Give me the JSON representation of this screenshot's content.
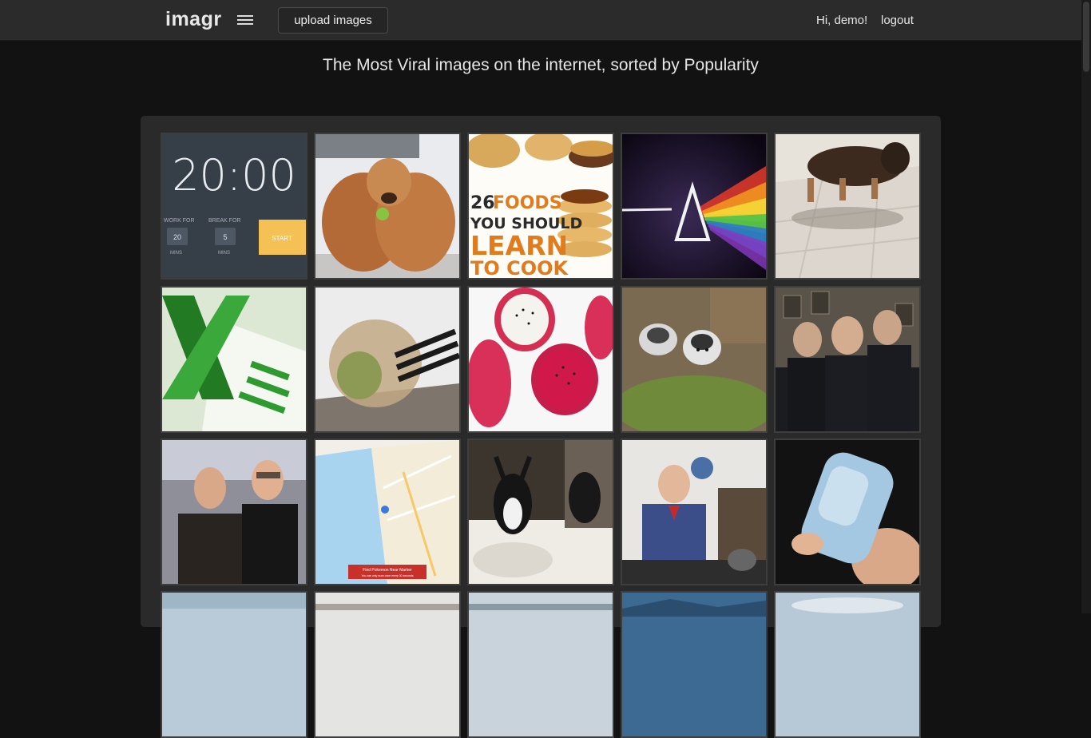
{
  "header": {
    "logo": "imagr",
    "upload_label": "upload images",
    "greeting": "Hi, demo!",
    "logout_label": "logout"
  },
  "headline": "The Most Viral images on the internet, sorted by Popularity",
  "gallery": {
    "tiles": [
      {
        "subject": "pomodoro timer",
        "time": "20:00",
        "work_label": "WORK FOR",
        "work_value": "20",
        "work_unit": "MINS",
        "break_label": "BREAK FOR",
        "break_value": "5",
        "break_unit": "MINS",
        "start_label": "START"
      },
      {
        "subject": "golden retrievers"
      },
      {
        "subject": "food poster",
        "line1_num": "26",
        "line1_word": "FOODS",
        "line2": "YOU SHOULD",
        "line3": "LEARN",
        "line4": "TO COOK"
      },
      {
        "subject": "prism rainbow"
      },
      {
        "subject": "german shepherd on tiles"
      },
      {
        "subject": "excel logo"
      },
      {
        "subject": "plastic bags and pipes"
      },
      {
        "subject": "dragon fruit"
      },
      {
        "subject": "husky dogs"
      },
      {
        "subject": "police officers"
      },
      {
        "subject": "two men portrait"
      },
      {
        "subject": "map",
        "map_title": "Find Pokemon Near Marker",
        "map_subtitle": "You can only scan once every 30 seconds"
      },
      {
        "subject": "cats at sink"
      },
      {
        "subject": "man at desk"
      },
      {
        "subject": "translucent stone"
      },
      {
        "subject": "sky partial"
      },
      {
        "subject": "winter partial"
      },
      {
        "subject": "snow partial"
      },
      {
        "subject": "mountain lake partial"
      },
      {
        "subject": "clouds partial"
      }
    ]
  }
}
